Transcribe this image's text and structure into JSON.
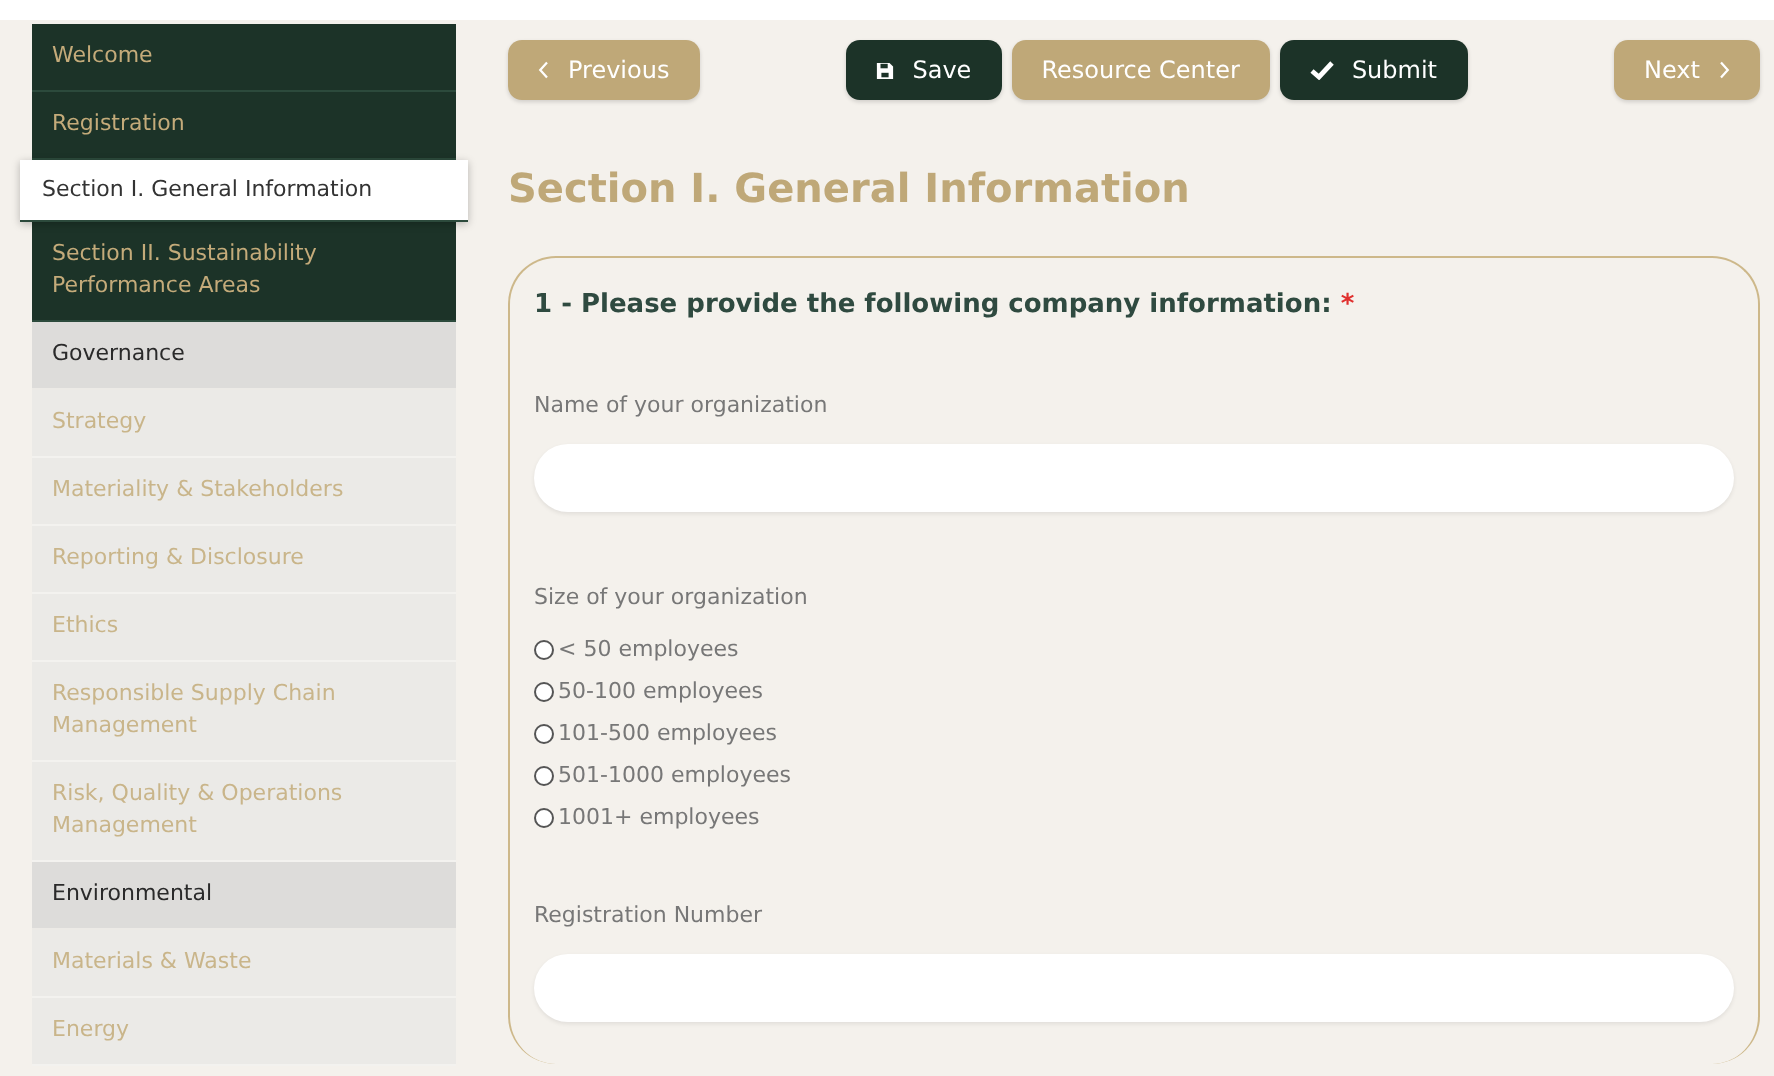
{
  "sidebar": {
    "items": [
      {
        "label": "Welcome",
        "kind": "section",
        "selected": false
      },
      {
        "label": "Registration",
        "kind": "section",
        "selected": false
      },
      {
        "label": "Section I. General Information",
        "kind": "section",
        "selected": true
      },
      {
        "label": "Section II. Sustainability Performance Areas",
        "kind": "section",
        "selected": false
      },
      {
        "label": "Governance",
        "kind": "group",
        "selected": false
      },
      {
        "label": "Strategy",
        "kind": "sub",
        "selected": false
      },
      {
        "label": "Materiality & Stakeholders",
        "kind": "sub",
        "selected": false
      },
      {
        "label": "Reporting & Disclosure",
        "kind": "sub",
        "selected": false
      },
      {
        "label": "Ethics",
        "kind": "sub",
        "selected": false
      },
      {
        "label": "Responsible Supply Chain Management",
        "kind": "sub",
        "selected": false
      },
      {
        "label": "Risk, Quality & Operations Management",
        "kind": "sub",
        "selected": false
      },
      {
        "label": "Environmental",
        "kind": "group",
        "selected": false
      },
      {
        "label": "Materials & Waste",
        "kind": "sub",
        "selected": false
      },
      {
        "label": "Energy",
        "kind": "sub",
        "selected": false
      }
    ]
  },
  "toolbar": {
    "buttons": [
      {
        "label": "Previous",
        "kind": "prev"
      },
      {
        "label": "Save",
        "kind": "save"
      },
      {
        "label": "Resource Center",
        "kind": "plain"
      },
      {
        "label": "Submit",
        "kind": "submit"
      },
      {
        "label": "Next",
        "kind": "next"
      }
    ]
  },
  "heading": "Section I. General Information",
  "question": {
    "title": "1 - Please provide the following company information:",
    "required_mark": "*",
    "fields": [
      {
        "kind": "text",
        "label": "Name of your organization"
      },
      {
        "kind": "radio",
        "label": "Size of your organization",
        "options": [
          {
            "label": "< 50 employees",
            "selected": false
          },
          {
            "label": "50-100 employees",
            "selected": false
          },
          {
            "label": "101-500 employees",
            "selected": false
          },
          {
            "label": "501-1000 employees",
            "selected": false
          },
          {
            "label": "1001+ employees",
            "selected": false
          }
        ]
      },
      {
        "kind": "text",
        "label": "Registration Number"
      }
    ]
  }
}
